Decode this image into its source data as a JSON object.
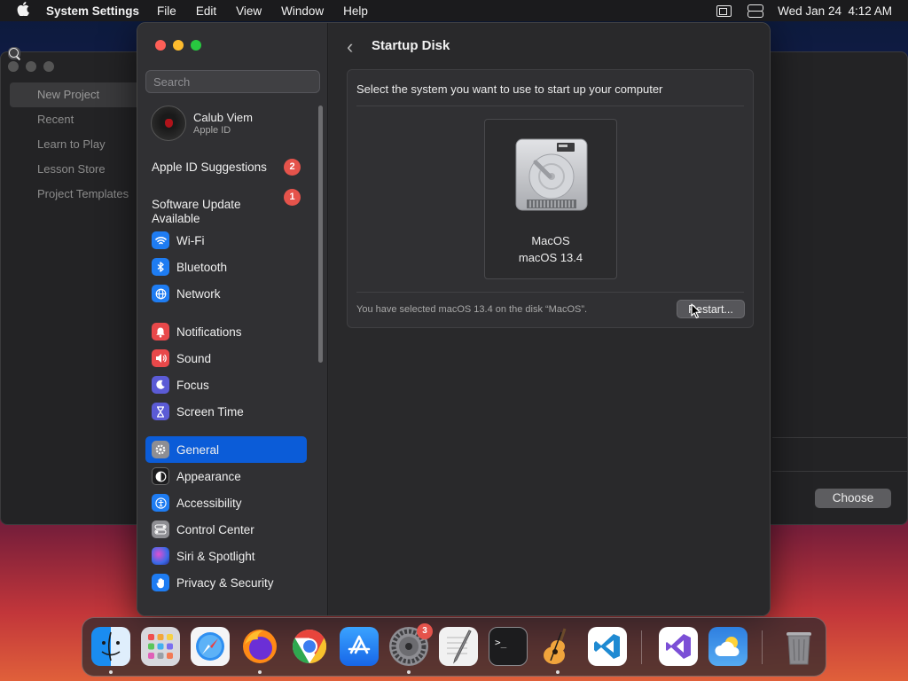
{
  "menubar": {
    "app_name": "System Settings",
    "menus": [
      "File",
      "Edit",
      "View",
      "Window",
      "Help"
    ],
    "datetime": "Wed Jan 24  4:12 AM"
  },
  "background_window": {
    "sidebar_items": [
      "New Project",
      "Recent",
      "Learn to Play",
      "Lesson Store",
      "Project Templates"
    ],
    "choose_label": "Choose"
  },
  "sidebar": {
    "search_placeholder": "Search",
    "profile": {
      "name": "Calub Viem",
      "subtitle": "Apple ID"
    },
    "suggestions": [
      {
        "label": "Apple ID Suggestions",
        "badge": "2"
      },
      {
        "label": "Software Update\nAvailable",
        "badge": "1"
      }
    ],
    "group1": [
      {
        "label": "Wi-Fi",
        "icon": "wifi-icon",
        "color": "#1e7cf2"
      },
      {
        "label": "Bluetooth",
        "icon": "bluetooth-icon",
        "color": "#1e7cf2"
      },
      {
        "label": "Network",
        "icon": "globe-icon",
        "color": "#1e7cf2"
      }
    ],
    "group2": [
      {
        "label": "Notifications",
        "icon": "bell-icon",
        "color": "#e8484a"
      },
      {
        "label": "Sound",
        "icon": "speaker-icon",
        "color": "#e8484a"
      },
      {
        "label": "Focus",
        "icon": "moon-icon",
        "color": "#5b5bd6"
      },
      {
        "label": "Screen Time",
        "icon": "hourglass-icon",
        "color": "#5b5bd6"
      }
    ],
    "group3": [
      {
        "label": "General",
        "icon": "gear-icon",
        "color": "#8e8e93",
        "active": true
      },
      {
        "label": "Appearance",
        "icon": "appearance-icon",
        "color": "#1c1c1e"
      },
      {
        "label": "Accessibility",
        "icon": "accessibility-icon",
        "color": "#1e7cf2"
      },
      {
        "label": "Control Center",
        "icon": "control-center-icon",
        "color": "#8e8e93"
      },
      {
        "label": "Siri & Spotlight",
        "icon": "siri-icon",
        "color": "#7a3fd6"
      },
      {
        "label": "Privacy & Security",
        "icon": "hand-icon",
        "color": "#1e7cf2"
      }
    ]
  },
  "content": {
    "title": "Startup Disk",
    "prompt": "Select the system you want to use to start up your computer",
    "disk": {
      "name": "MacOS",
      "version": "macOS 13.4"
    },
    "status": "You have selected macOS 13.4 on the disk “MacOS”.",
    "restart_label": "Restart..."
  },
  "dock": {
    "apps": [
      {
        "name": "finder",
        "color": "#1a8cf0",
        "running": true
      },
      {
        "name": "launchpad",
        "color": "#d9d9de",
        "running": false
      },
      {
        "name": "safari",
        "color": "#f4f4f6",
        "running": false
      },
      {
        "name": "firefox",
        "color": "#6b2fd6",
        "running": true
      },
      {
        "name": "chrome",
        "color": "#ffffff",
        "running": false
      },
      {
        "name": "app-store",
        "color": "#1e86f5",
        "running": false
      },
      {
        "name": "system-settings",
        "color": "#8d8d92",
        "running": true,
        "badge": "3"
      },
      {
        "name": "textedit",
        "color": "#f2f2f2",
        "running": false
      },
      {
        "name": "terminal",
        "color": "#1c1c1e",
        "running": false
      },
      {
        "name": "garageband",
        "color": "#2a2a2a",
        "running": true
      },
      {
        "name": "vscode",
        "color": "#ffffff",
        "running": false
      },
      {
        "name": "visual-studio",
        "color": "#ffffff",
        "running": false
      },
      {
        "name": "weather",
        "color": "#2e7fe0",
        "running": false
      },
      {
        "name": "trash",
        "color": "#8a8a8e",
        "running": false
      }
    ]
  }
}
